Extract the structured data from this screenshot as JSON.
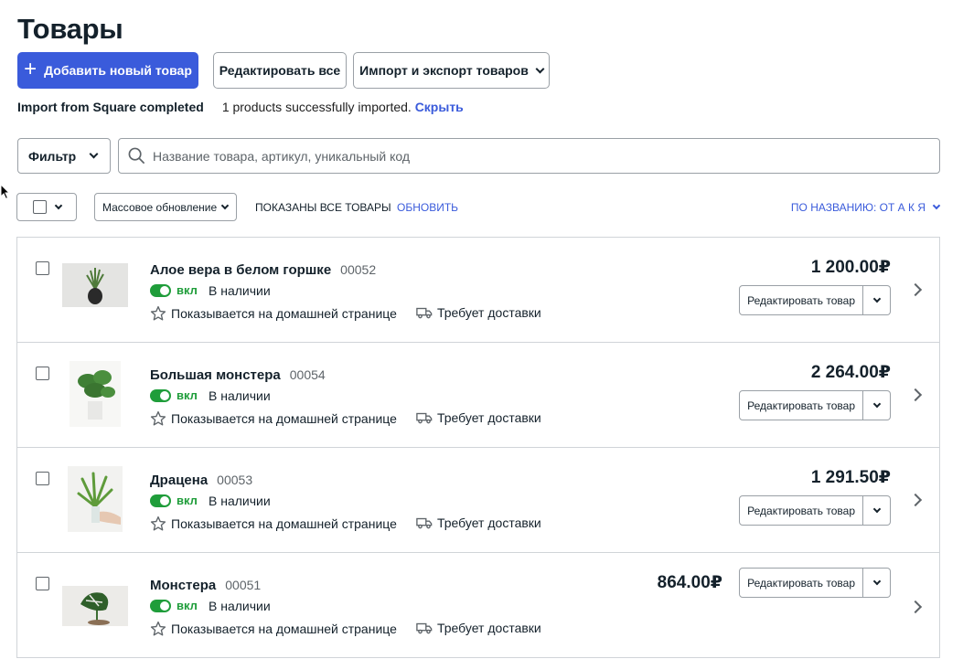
{
  "page": {
    "title": "Товары"
  },
  "toolbar": {
    "add_label": "Добавить новый товар",
    "edit_all_label": "Редактировать все",
    "import_export_label": "Импорт и экспорт товаров"
  },
  "import_status": {
    "title": "Import from Square completed",
    "message": "1 products successfully imported.",
    "hide_label": "Скрыть"
  },
  "filter": {
    "label": "Фильтр",
    "search_placeholder": "Название товара, артикул, уникальный код"
  },
  "list_controls": {
    "bulk_update_label": "Массовое обновление",
    "shown_label": "ПОКАЗАНЫ ВСЕ ТОВАРЫ",
    "refresh_label": "ОБНОВИТЬ",
    "sort_label": "ПО НАЗВАНИЮ: ОТ А К Я"
  },
  "products": [
    {
      "name": "Алое вера в белом горшке",
      "sku": "00052",
      "enabled_label": "вкл",
      "stock": "В наличии",
      "featured": "Показывается на домашней странице",
      "shipping": "Требует доставки",
      "price": "1 200.00₽",
      "edit_label": "Редактировать товар",
      "image": "aloe-plant"
    },
    {
      "name": "Большая монстера",
      "sku": "00054",
      "enabled_label": "вкл",
      "stock": "В наличии",
      "featured": "Показывается на домашней странице",
      "shipping": "Требует доставки",
      "price": "2 264.00₽",
      "edit_label": "Редактировать товар",
      "image": "monstera-plant"
    },
    {
      "name": "Драцена",
      "sku": "00053",
      "enabled_label": "вкл",
      "stock": "В наличии",
      "featured": "Показывается на домашней странице",
      "shipping": "Требует доставки",
      "price": "1 291.50₽",
      "edit_label": "Редактировать товар",
      "image": "dracaena-plant"
    },
    {
      "name": "Монстера",
      "sku": "00051",
      "enabled_label": "вкл",
      "stock": "В наличии",
      "featured": "Показывается на домашней странице",
      "shipping": "Требует доставки",
      "price": "864.00₽",
      "edit_label": "Редактировать товар",
      "image": "monstera-cutting"
    }
  ],
  "colors": {
    "accent": "#3a5bdb",
    "success": "#1f9d3a",
    "text": "#14212b",
    "border": "#9aa0a6"
  }
}
